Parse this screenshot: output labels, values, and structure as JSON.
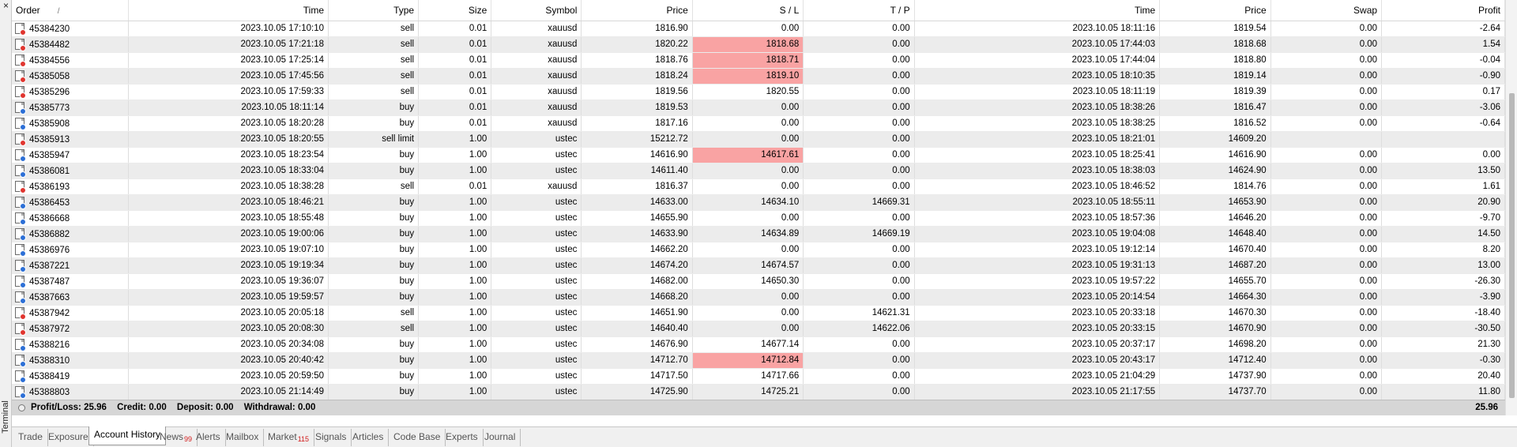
{
  "window": {
    "side_label": "Terminal",
    "close_glyph": "×"
  },
  "columns": [
    "Order",
    "Time",
    "Type",
    "Size",
    "Symbol",
    "Price",
    "S / L",
    "T / P",
    "Time",
    "Price",
    "Swap",
    "Profit"
  ],
  "sort_indicator": "/",
  "rows": [
    {
      "order": "45384230",
      "side": "sell",
      "open_time": "2023.10.05 17:10:10",
      "type": "sell",
      "size": "0.01",
      "symbol": "xauusd",
      "price": "1816.90",
      "sl": "0.00",
      "tp": "0.00",
      "close_time": "2023.10.05 18:11:16",
      "close_price": "1819.54",
      "swap": "0.00",
      "profit": "-2.64",
      "sl_hl": false,
      "alt": false
    },
    {
      "order": "45384482",
      "side": "sell",
      "open_time": "2023.10.05 17:21:18",
      "type": "sell",
      "size": "0.01",
      "symbol": "xauusd",
      "price": "1820.22",
      "sl": "1818.68",
      "tp": "0.00",
      "close_time": "2023.10.05 17:44:03",
      "close_price": "1818.68",
      "swap": "0.00",
      "profit": "1.54",
      "sl_hl": true,
      "alt": true
    },
    {
      "order": "45384556",
      "side": "sell",
      "open_time": "2023.10.05 17:25:14",
      "type": "sell",
      "size": "0.01",
      "symbol": "xauusd",
      "price": "1818.76",
      "sl": "1818.71",
      "tp": "0.00",
      "close_time": "2023.10.05 17:44:04",
      "close_price": "1818.80",
      "swap": "0.00",
      "profit": "-0.04",
      "sl_hl": true,
      "alt": false
    },
    {
      "order": "45385058",
      "side": "sell",
      "open_time": "2023.10.05 17:45:56",
      "type": "sell",
      "size": "0.01",
      "symbol": "xauusd",
      "price": "1818.24",
      "sl": "1819.10",
      "tp": "0.00",
      "close_time": "2023.10.05 18:10:35",
      "close_price": "1819.14",
      "swap": "0.00",
      "profit": "-0.90",
      "sl_hl": true,
      "alt": true
    },
    {
      "order": "45385296",
      "side": "sell",
      "open_time": "2023.10.05 17:59:33",
      "type": "sell",
      "size": "0.01",
      "symbol": "xauusd",
      "price": "1819.56",
      "sl": "1820.55",
      "tp": "0.00",
      "close_time": "2023.10.05 18:11:19",
      "close_price": "1819.39",
      "swap": "0.00",
      "profit": "0.17",
      "sl_hl": false,
      "alt": false
    },
    {
      "order": "45385773",
      "side": "buy",
      "open_time": "2023.10.05 18:11:14",
      "type": "buy",
      "size": "0.01",
      "symbol": "xauusd",
      "price": "1819.53",
      "sl": "0.00",
      "tp": "0.00",
      "close_time": "2023.10.05 18:38:26",
      "close_price": "1816.47",
      "swap": "0.00",
      "profit": "-3.06",
      "sl_hl": false,
      "alt": true
    },
    {
      "order": "45385908",
      "side": "buy",
      "open_time": "2023.10.05 18:20:28",
      "type": "buy",
      "size": "0.01",
      "symbol": "xauusd",
      "price": "1817.16",
      "sl": "0.00",
      "tp": "0.00",
      "close_time": "2023.10.05 18:38:25",
      "close_price": "1816.52",
      "swap": "0.00",
      "profit": "-0.64",
      "sl_hl": false,
      "alt": false
    },
    {
      "order": "45385913",
      "side": "sell",
      "open_time": "2023.10.05 18:20:55",
      "type": "sell limit",
      "size": "1.00",
      "symbol": "ustec",
      "price": "15212.72",
      "sl": "0.00",
      "tp": "0.00",
      "close_time": "2023.10.05 18:21:01",
      "close_price": "14609.20",
      "swap": "",
      "profit": "",
      "sl_hl": false,
      "alt": true
    },
    {
      "order": "45385947",
      "side": "buy",
      "open_time": "2023.10.05 18:23:54",
      "type": "buy",
      "size": "1.00",
      "symbol": "ustec",
      "price": "14616.90",
      "sl": "14617.61",
      "tp": "0.00",
      "close_time": "2023.10.05 18:25:41",
      "close_price": "14616.90",
      "swap": "0.00",
      "profit": "0.00",
      "sl_hl": true,
      "alt": false
    },
    {
      "order": "45386081",
      "side": "buy",
      "open_time": "2023.10.05 18:33:04",
      "type": "buy",
      "size": "1.00",
      "symbol": "ustec",
      "price": "14611.40",
      "sl": "0.00",
      "tp": "0.00",
      "close_time": "2023.10.05 18:38:03",
      "close_price": "14624.90",
      "swap": "0.00",
      "profit": "13.50",
      "sl_hl": false,
      "alt": true
    },
    {
      "order": "45386193",
      "side": "sell",
      "open_time": "2023.10.05 18:38:28",
      "type": "sell",
      "size": "0.01",
      "symbol": "xauusd",
      "price": "1816.37",
      "sl": "0.00",
      "tp": "0.00",
      "close_time": "2023.10.05 18:46:52",
      "close_price": "1814.76",
      "swap": "0.00",
      "profit": "1.61",
      "sl_hl": false,
      "alt": false
    },
    {
      "order": "45386453",
      "side": "buy",
      "open_time": "2023.10.05 18:46:21",
      "type": "buy",
      "size": "1.00",
      "symbol": "ustec",
      "price": "14633.00",
      "sl": "14634.10",
      "tp": "14669.31",
      "close_time": "2023.10.05 18:55:11",
      "close_price": "14653.90",
      "swap": "0.00",
      "profit": "20.90",
      "sl_hl": false,
      "alt": true
    },
    {
      "order": "45386668",
      "side": "buy",
      "open_time": "2023.10.05 18:55:48",
      "type": "buy",
      "size": "1.00",
      "symbol": "ustec",
      "price": "14655.90",
      "sl": "0.00",
      "tp": "0.00",
      "close_time": "2023.10.05 18:57:36",
      "close_price": "14646.20",
      "swap": "0.00",
      "profit": "-9.70",
      "sl_hl": false,
      "alt": false
    },
    {
      "order": "45386882",
      "side": "buy",
      "open_time": "2023.10.05 19:00:06",
      "type": "buy",
      "size": "1.00",
      "symbol": "ustec",
      "price": "14633.90",
      "sl": "14634.89",
      "tp": "14669.19",
      "close_time": "2023.10.05 19:04:08",
      "close_price": "14648.40",
      "swap": "0.00",
      "profit": "14.50",
      "sl_hl": false,
      "alt": true
    },
    {
      "order": "45386976",
      "side": "buy",
      "open_time": "2023.10.05 19:07:10",
      "type": "buy",
      "size": "1.00",
      "symbol": "ustec",
      "price": "14662.20",
      "sl": "0.00",
      "tp": "0.00",
      "close_time": "2023.10.05 19:12:14",
      "close_price": "14670.40",
      "swap": "0.00",
      "profit": "8.20",
      "sl_hl": false,
      "alt": false
    },
    {
      "order": "45387221",
      "side": "buy",
      "open_time": "2023.10.05 19:19:34",
      "type": "buy",
      "size": "1.00",
      "symbol": "ustec",
      "price": "14674.20",
      "sl": "14674.57",
      "tp": "0.00",
      "close_time": "2023.10.05 19:31:13",
      "close_price": "14687.20",
      "swap": "0.00",
      "profit": "13.00",
      "sl_hl": false,
      "alt": true
    },
    {
      "order": "45387487",
      "side": "buy",
      "open_time": "2023.10.05 19:36:07",
      "type": "buy",
      "size": "1.00",
      "symbol": "ustec",
      "price": "14682.00",
      "sl": "14650.30",
      "tp": "0.00",
      "close_time": "2023.10.05 19:57:22",
      "close_price": "14655.70",
      "swap": "0.00",
      "profit": "-26.30",
      "sl_hl": false,
      "alt": false
    },
    {
      "order": "45387663",
      "side": "buy",
      "open_time": "2023.10.05 19:59:57",
      "type": "buy",
      "size": "1.00",
      "symbol": "ustec",
      "price": "14668.20",
      "sl": "0.00",
      "tp": "0.00",
      "close_time": "2023.10.05 20:14:54",
      "close_price": "14664.30",
      "swap": "0.00",
      "profit": "-3.90",
      "sl_hl": false,
      "alt": true
    },
    {
      "order": "45387942",
      "side": "sell",
      "open_time": "2023.10.05 20:05:18",
      "type": "sell",
      "size": "1.00",
      "symbol": "ustec",
      "price": "14651.90",
      "sl": "0.00",
      "tp": "14621.31",
      "close_time": "2023.10.05 20:33:18",
      "close_price": "14670.30",
      "swap": "0.00",
      "profit": "-18.40",
      "sl_hl": false,
      "alt": false
    },
    {
      "order": "45387972",
      "side": "sell",
      "open_time": "2023.10.05 20:08:30",
      "type": "sell",
      "size": "1.00",
      "symbol": "ustec",
      "price": "14640.40",
      "sl": "0.00",
      "tp": "14622.06",
      "close_time": "2023.10.05 20:33:15",
      "close_price": "14670.90",
      "swap": "0.00",
      "profit": "-30.50",
      "sl_hl": false,
      "alt": true
    },
    {
      "order": "45388216",
      "side": "buy",
      "open_time": "2023.10.05 20:34:08",
      "type": "buy",
      "size": "1.00",
      "symbol": "ustec",
      "price": "14676.90",
      "sl": "14677.14",
      "tp": "0.00",
      "close_time": "2023.10.05 20:37:17",
      "close_price": "14698.20",
      "swap": "0.00",
      "profit": "21.30",
      "sl_hl": false,
      "alt": false
    },
    {
      "order": "45388310",
      "side": "buy",
      "open_time": "2023.10.05 20:40:42",
      "type": "buy",
      "size": "1.00",
      "symbol": "ustec",
      "price": "14712.70",
      "sl": "14712.84",
      "tp": "0.00",
      "close_time": "2023.10.05 20:43:17",
      "close_price": "14712.40",
      "swap": "0.00",
      "profit": "-0.30",
      "sl_hl": true,
      "alt": true
    },
    {
      "order": "45388419",
      "side": "buy",
      "open_time": "2023.10.05 20:59:50",
      "type": "buy",
      "size": "1.00",
      "symbol": "ustec",
      "price": "14717.50",
      "sl": "14717.66",
      "tp": "0.00",
      "close_time": "2023.10.05 21:04:29",
      "close_price": "14737.90",
      "swap": "0.00",
      "profit": "20.40",
      "sl_hl": false,
      "alt": false
    },
    {
      "order": "45388803",
      "side": "buy",
      "open_time": "2023.10.05 21:14:49",
      "type": "buy",
      "size": "1.00",
      "symbol": "ustec",
      "price": "14725.90",
      "sl": "14725.21",
      "tp": "0.00",
      "close_time": "2023.10.05 21:17:55",
      "close_price": "14737.70",
      "swap": "0.00",
      "profit": "11.80",
      "sl_hl": false,
      "alt": true
    }
  ],
  "summary": {
    "profit_loss": "Profit/Loss: 25.96",
    "credit": "Credit: 0.00",
    "deposit": "Deposit: 0.00",
    "withdrawal": "Withdrawal: 0.00",
    "total": "25.96"
  },
  "tabs": [
    {
      "label": "Trade",
      "badge": "",
      "active": false
    },
    {
      "label": "Exposure",
      "badge": "",
      "active": false
    },
    {
      "label": "Account History",
      "badge": "",
      "active": true
    },
    {
      "label": "News",
      "badge": "99",
      "active": false
    },
    {
      "label": "Alerts",
      "badge": "",
      "active": false
    },
    {
      "label": "Mailbox",
      "badge": "",
      "active": false
    },
    {
      "label": "Market",
      "badge": "115",
      "active": false
    },
    {
      "label": "Signals",
      "badge": "",
      "active": false
    },
    {
      "label": "Articles",
      "badge": "",
      "active": false
    },
    {
      "label": "Code Base",
      "badge": "",
      "active": false
    },
    {
      "label": "Experts",
      "badge": "",
      "active": false
    },
    {
      "label": "Journal",
      "badge": "",
      "active": false
    }
  ],
  "colors": {
    "highlight": "#f9a3a3",
    "alt_row": "#ececec",
    "sell_icon": "#e0352f",
    "buy_icon": "#2c6fd6",
    "badge": "#d21b1b"
  },
  "icons": {
    "sell": "sell-order-icon",
    "buy": "buy-order-icon"
  }
}
